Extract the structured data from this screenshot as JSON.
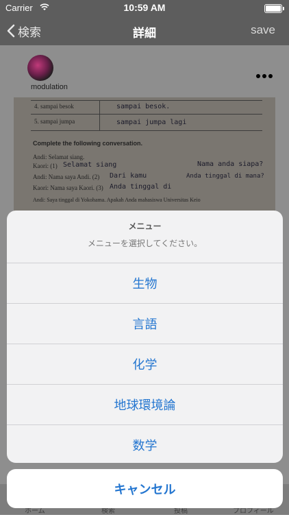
{
  "status_bar": {
    "carrier": "Carrier",
    "time": "10:59 AM"
  },
  "nav": {
    "back_label": "検索",
    "title": "詳細",
    "save_label": "save"
  },
  "post": {
    "username": "modulation",
    "photo_text": {
      "row4": "4. sampai besok",
      "row5": "5. sampai jumpa",
      "hand4": "sampai besok.",
      "hand5": "sampai jumpa lagi",
      "heading": "Complete the following conversation.",
      "line1": "Andi: Selamat siang.",
      "line2": "Kaori: (1)",
      "line2_hand": "Selamat siang",
      "line3": "Andi: Nama saya Andi. (2)",
      "line3_hand": "Dari kamu",
      "line4": "Kaori: Nama saya Kaori. (3)",
      "line4_hand": "Anda tinggal di",
      "line5": "Andi: Saya tinggal di Yokohama. Apakah Anda mahasiswa Universitas Keio",
      "note1": "Nama anda siapa?",
      "note2": "Anda tinggal di mana?"
    }
  },
  "action_sheet": {
    "title": "メニュー",
    "message": "メニューを選択してください。",
    "options": [
      "生物",
      "言語",
      "化学",
      "地球環境論",
      "数学"
    ],
    "cancel_label": "キャンセル"
  },
  "tab_bar": {
    "items": [
      "ホーム",
      "検索",
      "投稿",
      "プロフィール"
    ]
  },
  "colors": {
    "accent": "#2476d0",
    "nav_background": "#5d5d5d"
  }
}
